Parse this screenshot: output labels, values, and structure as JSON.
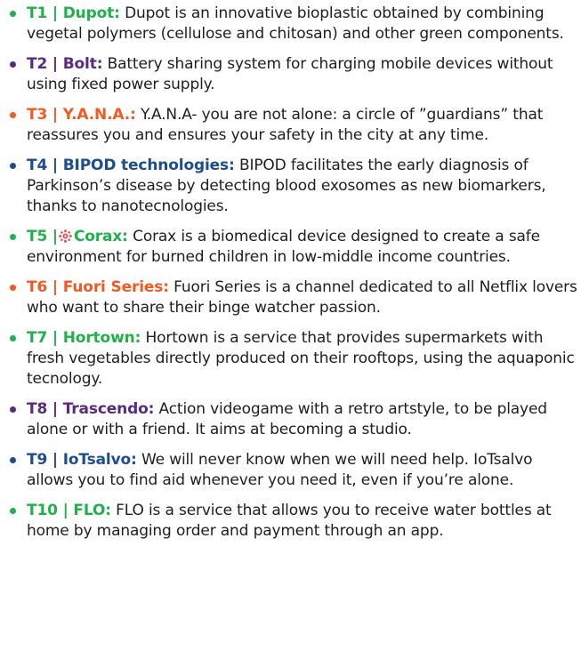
{
  "colors": {
    "green": "#1fb24b",
    "purple": "#5a2a82",
    "orange": "#f15a22",
    "blue": "#1d4d8f",
    "body_text": "#1e1e1e"
  },
  "items": [
    {
      "label": "T1 | Dupot:",
      "description": "Dupot is an innovative bioplastic obtained by combining vegetal polymers (cellulose and chitosan) and other green components.",
      "color": "#1fb24b"
    },
    {
      "label": "T2 | Bolt:",
      "description": "Battery sharing system for charging mobile devices without using fixed power supply.",
      "color": "#5a2a82"
    },
    {
      "label": "T3 | Y.A.N.A.:",
      "description": "Y.A.N.A- you are not alone: a circle of ”guardians” that reassures you and ensures your safety in the city at any time.",
      "color": "#f15a22"
    },
    {
      "label": "T4 | BIPOD technologies:",
      "description": "BIPOD facilitates the early diagnosis of Parkinson’s disease by detecting blood exosomes as new biomarkers, thanks to nanotecnologies.",
      "color": "#1d4d8f"
    },
    {
      "label_prefix": "T5 |",
      "label": "Corax:",
      "icon": "gear-icon",
      "description": "Corax is a biomedical device designed to create a safe environment for burned children in low-middle income countries.",
      "color": "#1fb24b"
    },
    {
      "label": "T6 | Fuori Series:",
      "description": "Fuori Series is a channel dedicated to all Netflix lovers who want to share their binge watcher passion.",
      "color": "#f15a22"
    },
    {
      "label": "T7 | Hortown:",
      "description": "Hortown is a service that provides supermarkets with fresh vegetables directly produced on their rooftops, using the aquaponic tecnology.",
      "color": "#1fb24b"
    },
    {
      "label": "T8 | Trascendo:",
      "description": "Action videogame with a retro artstyle, to be played alone or with a friend. It aims at becoming a studio.",
      "color": "#5a2a82"
    },
    {
      "label": "T9 | IoTsalvo:",
      "description": "We will never know when we will need help. IoTsalvo allows you to find aid whenever you need it, even if you’re alone.",
      "color": "#1d4d8f"
    },
    {
      "label": "T10 | FLO:",
      "description": "FLO is a service that allows you to receive water bottles at home by managing order and payment through an app.",
      "color": "#1fb24b"
    }
  ]
}
